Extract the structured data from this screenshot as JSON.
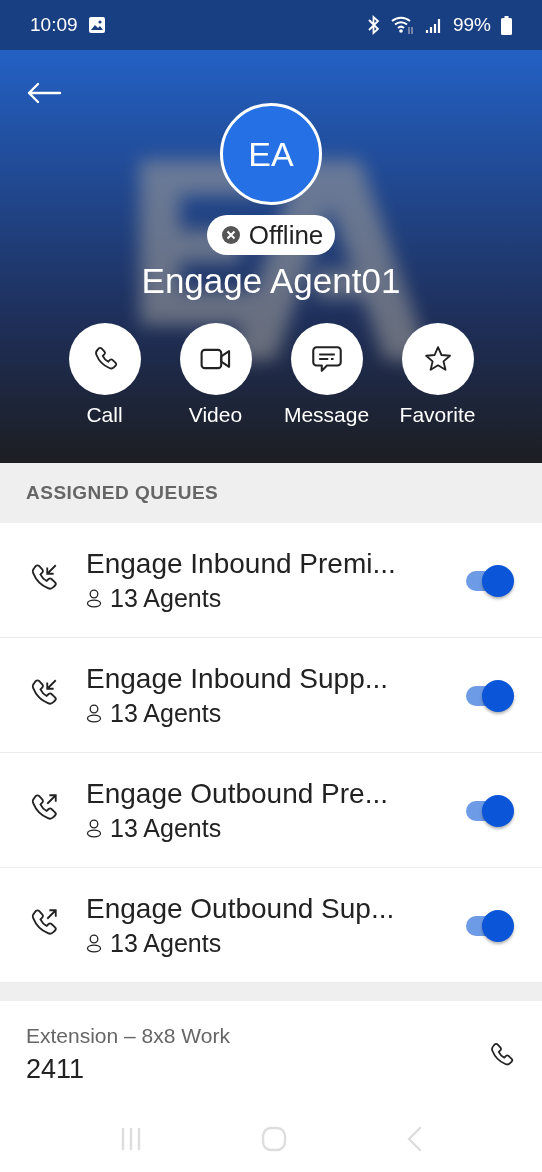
{
  "status_bar": {
    "time": "10:09",
    "battery": "99%"
  },
  "profile": {
    "initials": "EA",
    "status": "Offline",
    "name": "Engage Agent01"
  },
  "actions": [
    {
      "kind": "call",
      "label": "Call"
    },
    {
      "kind": "video",
      "label": "Video"
    },
    {
      "kind": "message",
      "label": "Message"
    },
    {
      "kind": "favorite",
      "label": "Favorite"
    }
  ],
  "queues_header": "ASSIGNED QUEUES",
  "queues": [
    {
      "kind": "inbound",
      "name": "Engage Inbound Premi...",
      "agents": "13 Agents",
      "on": true
    },
    {
      "kind": "inbound",
      "name": "Engage Inbound Supp...",
      "agents": "13 Agents",
      "on": true
    },
    {
      "kind": "outbound",
      "name": "Engage Outbound Pre...",
      "agents": "13 Agents",
      "on": true
    },
    {
      "kind": "outbound",
      "name": "Engage Outbound Sup...",
      "agents": "13 Agents",
      "on": true
    }
  ],
  "extension": {
    "label": "Extension – 8x8 Work",
    "number": "2411"
  }
}
